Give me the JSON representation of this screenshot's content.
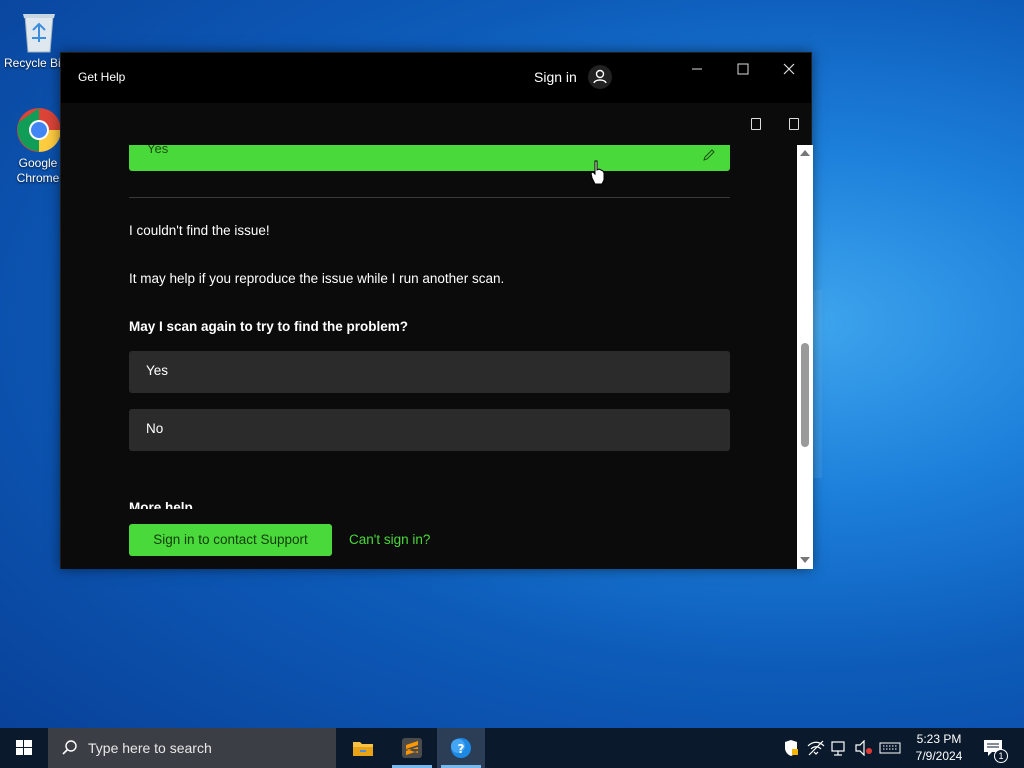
{
  "desktop": {
    "icons": [
      {
        "label": "Recycle Bin"
      },
      {
        "label": "Google Chrome"
      }
    ]
  },
  "window": {
    "app_title": "Get Help",
    "signin_label": "Sign in",
    "controls": {
      "minimize": "—",
      "maximize": "☐",
      "close": "✕"
    }
  },
  "conversation": {
    "prev_answer": "Yes",
    "message1": "I couldn't find the issue!",
    "message2": "It may help if you reproduce the issue while I run another scan.",
    "question": "May I scan again to try to find the problem?",
    "choices": [
      "Yes",
      "No"
    ],
    "more_help": "More help"
  },
  "footer": {
    "primary_button": "Sign in to contact Support",
    "link": "Can't sign in?"
  },
  "taskbar": {
    "search_placeholder": "Type here to search",
    "apps": [
      "file-explorer",
      "sublime-text",
      "get-help"
    ],
    "clock_time": "5:23 PM",
    "clock_date": "7/9/2024",
    "notification_count": "1"
  },
  "colors": {
    "accent_green": "#4ad93a",
    "window_bg": "#0b0b0b",
    "choice_bg": "#2b2b2b"
  }
}
